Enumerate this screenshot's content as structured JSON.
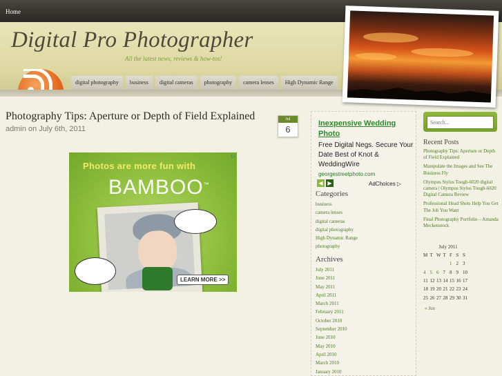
{
  "topbar": {
    "home": "Home"
  },
  "header": {
    "title": "Digital Pro Photographer",
    "tagline": "All the latest news, reviews & how-tos!"
  },
  "nav": [
    "digital photography",
    "business",
    "digital cameras",
    "photography",
    "camera lenses",
    "High Dynamic Range"
  ],
  "post": {
    "title": "Photography Tips: Aperture or Depth of Field Explained",
    "meta": "admin on July 6th, 2011",
    "date_month": "Jul",
    "date_day": "6"
  },
  "image_ad": {
    "line1": "Photos are more fun with",
    "brand": "BAMBOO",
    "trademark": "™",
    "cta": "LEARN MORE >>"
  },
  "text_ad": {
    "title": "Inexpensive Wedding Photo",
    "body": "Free Digital Negs. Secure Your Date Best of Knot & WeddingWire",
    "url": "georgestreetphoto.com",
    "adchoices": "AdChoices ▷"
  },
  "categories": {
    "heading": "Categories",
    "items": [
      "business",
      "camera lenses",
      "digital cameras",
      "digital photography",
      "High Dynamic Range",
      "photography"
    ]
  },
  "archives": {
    "heading": "Archives",
    "items": [
      "July 2011",
      "June 2011",
      "May 2011",
      "April 2011",
      "March 2011",
      "February 2011",
      "October 2010",
      "September 2010",
      "June 2010",
      "May 2010",
      "April 2010",
      "March 2010",
      "January 2010"
    ]
  },
  "search": {
    "placeholder": "Search..."
  },
  "recent_posts": {
    "heading": "Recent Posts",
    "items": [
      "Photography Tips: Aperture or Depth of Field Explained",
      "Manipulate the Images and See The Business Fly",
      "Olympus Stylus Tough-6020 digital camera | Olympus Stylus Tough-6020 Digital Camera Review",
      "Professional Head Shots Help You Get The Job You Want",
      "Final Photography Portfolio – Amanda Meckenstock"
    ]
  },
  "calendar": {
    "title": "July 2011",
    "days": [
      "M",
      "T",
      "W",
      "T",
      "F",
      "S",
      "S"
    ],
    "weeks": [
      [
        "",
        "",
        "",
        "",
        "1",
        "2",
        "3"
      ],
      [
        "4",
        "5",
        "6",
        "7",
        "8",
        "9",
        "10"
      ],
      [
        "11",
        "12",
        "13",
        "14",
        "15",
        "16",
        "17"
      ],
      [
        "18",
        "19",
        "20",
        "21",
        "22",
        "23",
        "24"
      ],
      [
        "25",
        "26",
        "27",
        "28",
        "29",
        "30",
        "31"
      ]
    ],
    "linked_days": [
      "1",
      "4",
      "5",
      "6"
    ],
    "prev": "« Jun"
  },
  "colors": {
    "accent_green": "#4a7a20",
    "header_bg": "#e2ddab",
    "topbar_bg": "#2a2724",
    "rss_orange": "#e2661c"
  }
}
